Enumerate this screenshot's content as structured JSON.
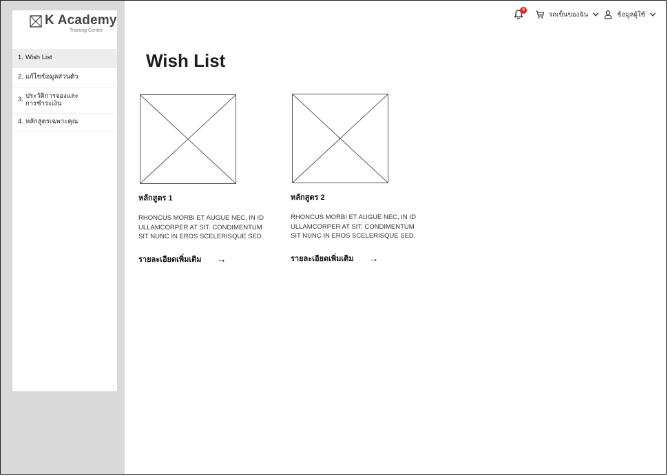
{
  "brand": {
    "name": "K Academy",
    "subtitle": "Training Center",
    "icon": "image-placeholder-icon"
  },
  "sidebar": {
    "items": [
      {
        "num": "1.",
        "label": "Wish List",
        "active": true
      },
      {
        "num": "2.",
        "label": "แก้ไขข้อมูลส่วนตัว",
        "active": false
      },
      {
        "num": "3.",
        "label": "ประวัติการจองและ การชำระเงิน",
        "active": false
      },
      {
        "num": "4.",
        "label": "หลักสูตรเฉพาะคุณ",
        "active": false
      }
    ]
  },
  "header": {
    "notification_icon": "bell-icon",
    "notification_count": "0",
    "cart_icon": "cart-icon",
    "cart_label": "รถเข็นของฉัน",
    "user_icon": "user-icon",
    "user_label": "ข้อมูลผู้ใช้"
  },
  "main": {
    "title": "Wish List",
    "courses": [
      {
        "title": "หลักสูตร 1",
        "description": "RHONCUS MORBI ET AUGUE NEC, IN ID ULLAMCORPER AT SIT. CONDIMENTUM SIT NUNC IN EROS SCELERISQUE SED.",
        "link_label": "รายละเอียดเพิ่มเติม",
        "arrow": "→"
      },
      {
        "title": "หลักสูตร 2",
        "description": "RHONCUS MORBI ET AUGUE NEC, IN ID ULLAMCORPER AT SIT. CONDIMENTUM SIT NUNC IN EROS SCELERISQUE SED.",
        "link_label": "รายละเอียดเพิ่มเติม",
        "arrow": "→"
      }
    ]
  },
  "colors": {
    "sidebar_bg": "#d9d9d9",
    "badge": "#e0251b",
    "active_item": "#ededed"
  }
}
